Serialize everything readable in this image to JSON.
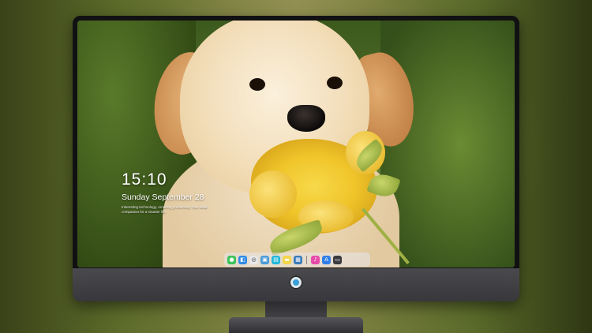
{
  "lock_screen": {
    "time": "15:10",
    "date": "Sunday September 28",
    "tagline": "Interesting technology, Amazing productivity Your ideal companion for a smarter life"
  },
  "dock": {
    "icons": [
      {
        "name": "messages-icon",
        "color": "#3cc45a",
        "glyph": "●"
      },
      {
        "name": "finder-icon",
        "color": "#2f8ae6",
        "glyph": "◧"
      },
      {
        "name": "safari-icon",
        "color": "#e8e8ea",
        "glyph": "◎"
      },
      {
        "name": "photos-icon",
        "color": "#4a9ad8",
        "glyph": "▣"
      },
      {
        "name": "appstore-icon",
        "color": "#23b6d8",
        "glyph": "▤"
      },
      {
        "name": "notes-icon",
        "color": "#f4d54a",
        "glyph": "▬"
      },
      {
        "name": "preview-icon",
        "color": "#3a7ab8",
        "glyph": "▦"
      },
      {
        "name": "music-icon",
        "color": "#e84aa8",
        "glyph": "♪"
      },
      {
        "name": "store-icon",
        "color": "#2f7ee8",
        "glyph": "A"
      },
      {
        "name": "terminal-icon",
        "color": "#3a3a40",
        "glyph": "▭"
      }
    ]
  }
}
